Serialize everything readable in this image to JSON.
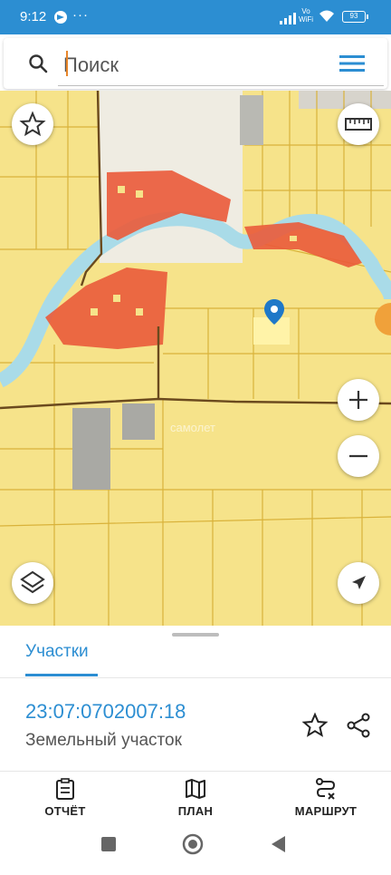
{
  "status_bar": {
    "time": "9:12",
    "vowifi": "Vo\nWiFi",
    "battery": "93",
    "icons": [
      "telegram-icon",
      "more-dots-icon",
      "signal-icon",
      "wifi-icon",
      "battery-icon"
    ]
  },
  "search": {
    "placeholder": "Поиск",
    "value": ""
  },
  "map": {
    "watermark": "самолет",
    "watermark_sub": "",
    "colors": {
      "land": "#f6e38a",
      "river": "#a9dbe8",
      "built_up": "#ea5a3a",
      "boundary": "#6b4a1e",
      "marker": "#1f78c8"
    }
  },
  "panel": {
    "tab_label": "Участки",
    "parcel_id": "23:07:0702007:18",
    "parcel_type": "Земельный участок"
  },
  "bottom_nav": {
    "items": [
      {
        "label": "ОТЧЁТ",
        "icon": "report-icon"
      },
      {
        "label": "ПЛАН",
        "icon": "map-plan-icon"
      },
      {
        "label": "МАРШРУТ",
        "icon": "route-icon"
      }
    ]
  },
  "colors": {
    "accent": "#2c8ed2",
    "status_bar": "#2c8ed2"
  }
}
